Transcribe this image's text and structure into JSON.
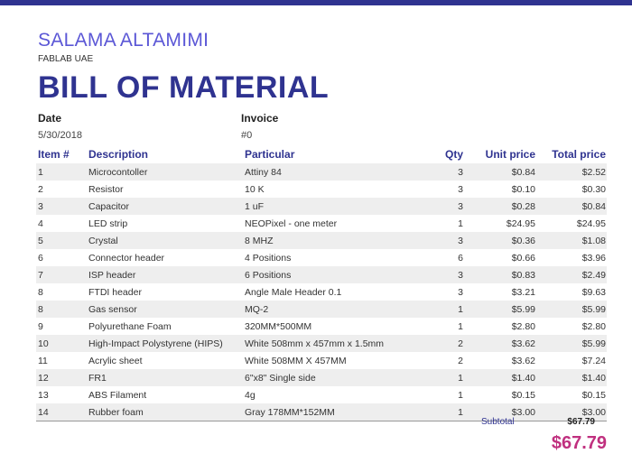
{
  "header": {
    "author": "SALAMA ALTAMIMI",
    "company": "FABLAB UAE",
    "title": "BILL OF MATERIAL"
  },
  "meta": {
    "date_label": "Date",
    "date_value": "5/30/2018",
    "invoice_label": "Invoice",
    "invoice_value": "#0"
  },
  "table": {
    "headers": {
      "item": "Item #",
      "description": "Description",
      "particular": "Particular",
      "qty": "Qty",
      "unit_price": "Unit price",
      "total_price": "Total price"
    },
    "rows": [
      {
        "item": "1",
        "description": "Microcontoller",
        "particular": "Attiny 84",
        "qty": "3",
        "unit": "$0.84",
        "total": "$2.52"
      },
      {
        "item": "2",
        "description": "Resistor",
        "particular": " 10 K",
        "qty": "3",
        "unit": "$0.10",
        "total": "$0.30"
      },
      {
        "item": "3",
        "description": "Capacitor",
        "particular": "1 uF",
        "qty": "3",
        "unit": "$0.28",
        "total": "$0.84"
      },
      {
        "item": "4",
        "description": "LED strip",
        "particular": "NEOPixel - one meter",
        "qty": "1",
        "unit": "$24.95",
        "total": "$24.95"
      },
      {
        "item": "5",
        "description": "Crystal",
        "particular": "8 MHZ",
        "qty": "3",
        "unit": "$0.36",
        "total": "$1.08"
      },
      {
        "item": "6",
        "description": "Connector header",
        "particular": "4 Positions",
        "qty": "6",
        "unit": "$0.66",
        "total": "$3.96"
      },
      {
        "item": "7",
        "description": "ISP header",
        "particular": "6 Positions",
        "qty": "3",
        "unit": "$0.83",
        "total": "$2.49"
      },
      {
        "item": "8",
        "description": "FTDI header",
        "particular": "Angle Male Header 0.1",
        "qty": "3",
        "unit": "$3.21",
        "total": "$9.63"
      },
      {
        "item": "8",
        "description": "Gas sensor",
        "particular": "MQ-2",
        "qty": "1",
        "unit": "$5.99",
        "total": "$5.99"
      },
      {
        "item": "9",
        "description": "Polyurethane Foam",
        "particular": "320MM*500MM",
        "qty": "1",
        "unit": "$2.80",
        "total": "$2.80"
      },
      {
        "item": "10",
        "description": "High-Impact Polystyrene (HIPS)",
        "particular": "White 508mm x 457mm x 1.5mm",
        "qty": "2",
        "unit": "$3.62",
        "total": "$5.99"
      },
      {
        "item": "11",
        "description": "Acrylic sheet",
        "particular": "White 508MM X 457MM",
        "qty": "2",
        "unit": "$3.62",
        "total": "$7.24"
      },
      {
        "item": "12",
        "description": "FR1",
        "particular": "6\"x8\" Single side",
        "qty": "1",
        "unit": "$1.40",
        "total": "$1.40"
      },
      {
        "item": "13",
        "description": "ABS Filament",
        "particular": "4g",
        "qty": "1",
        "unit": "$0.15",
        "total": "$0.15"
      },
      {
        "item": "14",
        "description": "Rubber foam",
        "particular": "Gray 178MM*152MM",
        "qty": "1",
        "unit": "$3.00",
        "total": "$3.00"
      }
    ]
  },
  "totals": {
    "subtotal_label": "Subtotal",
    "subtotal_value": "$67.79",
    "grand_total": "$67.79"
  },
  "colors": {
    "accent": "#2f3390",
    "author": "#5b57d6",
    "total": "#c0307f",
    "row_stripe": "#eeeeee"
  }
}
